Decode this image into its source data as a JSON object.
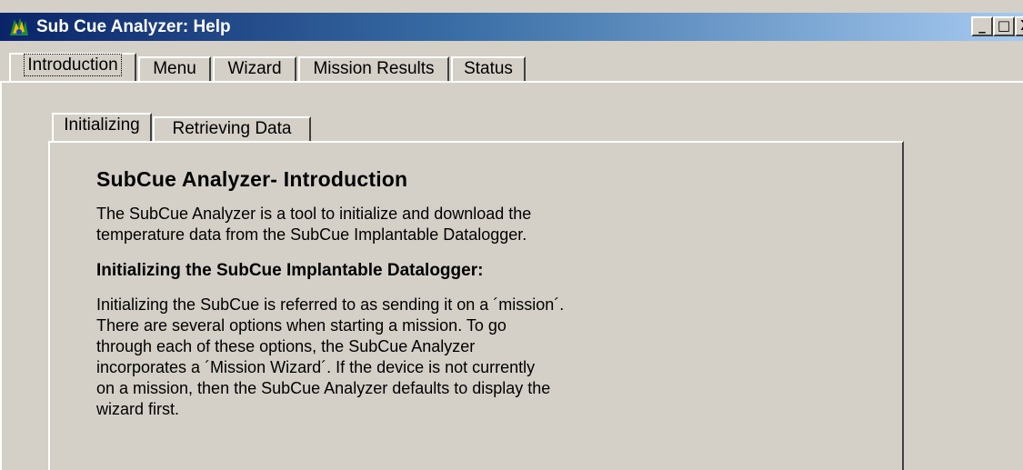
{
  "window": {
    "title": "Sub Cue Analyzer: Help",
    "icon": "app-icon",
    "controls": {
      "minimize": "_",
      "maximize": "□",
      "close": "X"
    }
  },
  "outer_tabs": [
    {
      "label": "Introduction",
      "active": true
    },
    {
      "label": "Menu",
      "active": false
    },
    {
      "label": "Wizard",
      "active": false
    },
    {
      "label": "Mission Results",
      "active": false
    },
    {
      "label": "Status",
      "active": false
    }
  ],
  "inner_tabs": [
    {
      "label": "Initializing",
      "active": true
    },
    {
      "label": "Retrieving Data",
      "active": false
    }
  ],
  "content": {
    "heading": "SubCue Analyzer- Introduction",
    "intro_lines": [
      "The SubCue Analyzer is a tool to initialize and download the",
      "temperature data from the SubCue Implantable Datalogger."
    ],
    "subheading": "Initializing the SubCue Implantable Datalogger:",
    "body_lines": [
      "Initializing the SubCue is referred to as sending it on a ´mission´.",
      "There are several options when starting a mission. To go",
      "through each of these options, the SubCue Analyzer",
      "incorporates a ´Mission Wizard´. If the device is not currently",
      "on a mission, then the SubCue Analyzer defaults to display the",
      "wizard first."
    ]
  },
  "colors": {
    "title_bar_start": "#0a246a",
    "title_bar_end": "#a6caf0",
    "face": "#d4d0c8"
  }
}
